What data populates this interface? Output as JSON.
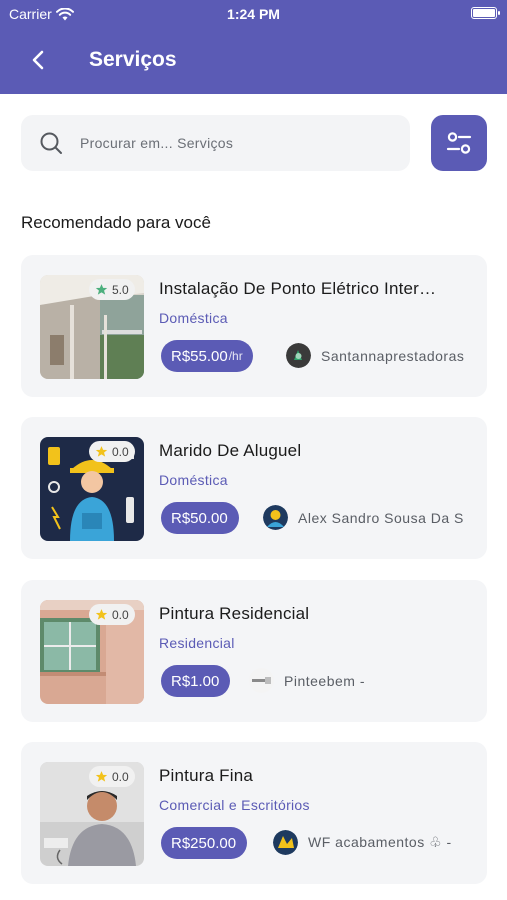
{
  "status_bar": {
    "carrier": "Carrier",
    "time": "1:24 PM"
  },
  "header": {
    "title": "Serviços"
  },
  "search": {
    "placeholder": "Procurar em... Serviços"
  },
  "section_title": "Recomendado para você",
  "colors": {
    "primary": "#5b5bb5",
    "card_bg": "#f4f5f7",
    "star_green": "#4caf7d",
    "star_gold": "#f2c21b"
  },
  "services": [
    {
      "title": "Instalação De Ponto Elétrico Inter…",
      "category": "Doméstica",
      "price": "R$55.00",
      "unit": "/hr",
      "provider": "Santannaprestadoras",
      "rating": "5.0",
      "star_icon": "star-green-icon"
    },
    {
      "title": "Marido De Aluguel",
      "category": "Doméstica",
      "price": "R$50.00",
      "unit": "",
      "provider": "Alex Sandro Sousa Da S",
      "rating": "0.0",
      "star_icon": "star-gold-icon"
    },
    {
      "title": "Pintura Residencial",
      "category": "Residencial",
      "price": "R$1.00",
      "unit": "",
      "provider": "Pinteebem -",
      "rating": "0.0",
      "star_icon": "star-gold-icon"
    },
    {
      "title": "Pintura Fina",
      "category": "Comercial e Escritórios",
      "price": "R$250.00",
      "unit": "",
      "provider": "WF acabamentos ♧ -",
      "rating": "0.0",
      "star_icon": "star-gold-icon"
    }
  ]
}
